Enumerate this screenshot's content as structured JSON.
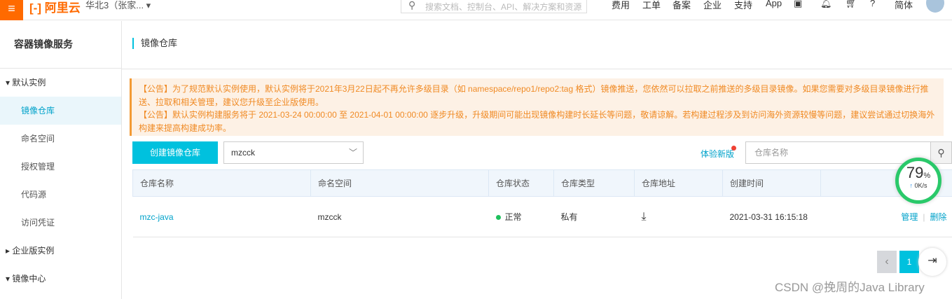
{
  "topbar": {
    "logo": "[-] 阿里云",
    "region": "华北3（张家... ▾",
    "search_placeholder": "搜索文档、控制台、API、解决方案和资源",
    "nav": [
      "费用",
      "工单",
      "备案",
      "企业",
      "支持",
      "App"
    ],
    "lang": "简体"
  },
  "sidebar": {
    "title": "容器镜像服务",
    "groups": [
      {
        "label": "▾ 默认实例"
      },
      {
        "label": "▸ 企业版实例"
      },
      {
        "label": "▾ 镜像中心"
      }
    ],
    "items": [
      "镜像仓库",
      "命名空间",
      "授权管理",
      "代码源",
      "访问凭证"
    ]
  },
  "main": {
    "title": "镜像仓库",
    "notice": [
      "【公告】为了规范默认实例使用，默认实例将于2021年3月22日起不再允许多级目录（如 namespace/repo1/repo2:tag 格式）镜像推送，您依然可以拉取之前推送的多级目录镜像。如果您需要对多级目录镜像进行推送、拉取和相关管理，建议您升级至企业版使用。",
      "【公告】默认实例构建服务将于 2021-03-24 00:00:00 至 2021-04-01 00:00:00 逐步升级，升级期间可能出现镜像构建时长延长等问题，敬请谅解。若构建过程涉及到访问海外资源较慢等问题，建议尝试通过切换海外构建来提高构建成功率。"
    ],
    "create_label": "创建镜像仓库",
    "namespace_value": "mzcck",
    "new_version": "体验新版",
    "search_placeholder": "仓库名称",
    "columns": [
      "仓库名称",
      "命名空间",
      "仓库状态",
      "仓库类型",
      "仓库地址",
      "创建时间",
      ""
    ],
    "rows": [
      {
        "name": "mzc-java",
        "namespace": "mzcck",
        "status": "正常",
        "type": "私有",
        "created": "2021-03-31 16:15:18",
        "manage": "管理",
        "delete": "删除"
      }
    ],
    "page": "1"
  },
  "gauge": {
    "percent": "79",
    "unit": "%",
    "speed": "0K/s"
  },
  "watermark": "CSDN @挽周的Java Library"
}
